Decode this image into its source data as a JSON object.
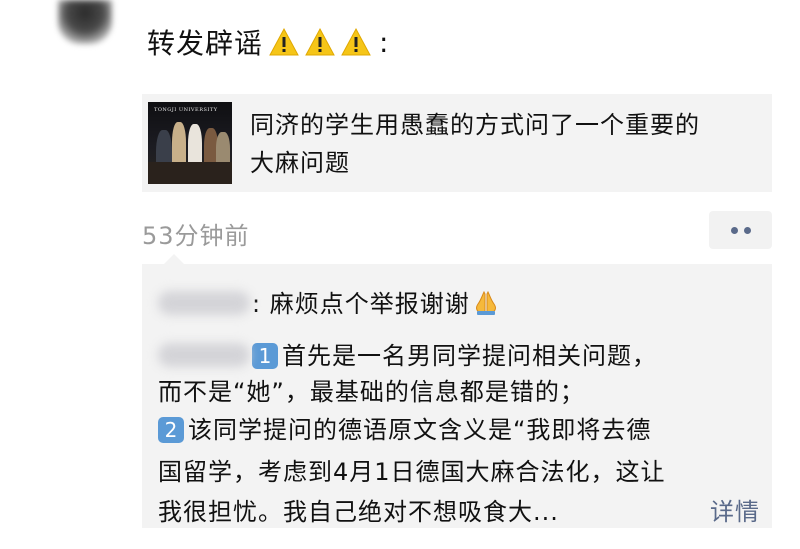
{
  "post": {
    "title": "转发辟谣",
    "title_suffix": ":",
    "warning_icon_count": 3,
    "link": {
      "thumbnail_caption": "TONGJI UNIVERSITY",
      "text_line1": "同济的学生用愚蠢的方式问了一个重要的",
      "text_line2": "大麻问题"
    },
    "timestamp": "53分钟前"
  },
  "comments": {
    "first": {
      "text": ": 麻烦点个举报谢谢"
    },
    "second": {
      "line1": "首先是一名男同学提问相关问题，",
      "line2": "而不是“她”，最基础的信息都是错的；",
      "line3": "该同学提问的德语原文含义是“我即将去德",
      "line4": "国留学，考虑到4月1日德国大麻合法化，这让",
      "line5": "我很担忧。我自己绝对不想吸食大...",
      "num1": "1",
      "num2": "2"
    },
    "details_label": "详情"
  },
  "colors": {
    "card_bg": "#f3f3f3",
    "time_gray": "#9a9a9a",
    "link_blue": "#5a6a8a",
    "keycap_blue": "#5b9ad6",
    "warning_yellow": "#f5c518"
  }
}
